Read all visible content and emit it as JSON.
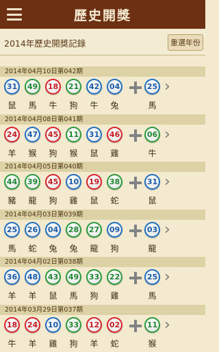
{
  "header": {
    "title": "歷史開獎"
  },
  "subheader": {
    "title": "2014年歷史開獎記錄",
    "reselect_label": "重選年份"
  },
  "colors": {
    "red": "#d8242a",
    "blue": "#1f6fc0",
    "green": "#2a9a3b",
    "topbar": "#6e3013"
  },
  "draws": [
    {
      "date": "2014年04月10日第042期",
      "balls": [
        {
          "n": "31",
          "c": "blue"
        },
        {
          "n": "49",
          "c": "green"
        },
        {
          "n": "18",
          "c": "red"
        },
        {
          "n": "21",
          "c": "green"
        },
        {
          "n": "42",
          "c": "blue"
        },
        {
          "n": "04",
          "c": "blue"
        }
      ],
      "special": {
        "n": "25",
        "c": "blue"
      },
      "zodiac": [
        "鼠",
        "馬",
        "牛",
        "狗",
        "牛",
        "兔"
      ],
      "special_zodiac": "馬"
    },
    {
      "date": "2014年04月08日第041期",
      "balls": [
        {
          "n": "24",
          "c": "red"
        },
        {
          "n": "47",
          "c": "blue"
        },
        {
          "n": "45",
          "c": "red"
        },
        {
          "n": "11",
          "c": "green"
        },
        {
          "n": "31",
          "c": "blue"
        },
        {
          "n": "46",
          "c": "red"
        }
      ],
      "special": {
        "n": "06",
        "c": "green"
      },
      "zodiac": [
        "羊",
        "猴",
        "狗",
        "猴",
        "鼠",
        "雞"
      ],
      "special_zodiac": "牛"
    },
    {
      "date": "2014年04月05日第040期",
      "balls": [
        {
          "n": "44",
          "c": "green"
        },
        {
          "n": "39",
          "c": "green"
        },
        {
          "n": "45",
          "c": "red"
        },
        {
          "n": "10",
          "c": "blue"
        },
        {
          "n": "19",
          "c": "red"
        },
        {
          "n": "38",
          "c": "green"
        }
      ],
      "special": {
        "n": "31",
        "c": "blue"
      },
      "zodiac": [
        "豬",
        "龍",
        "狗",
        "雞",
        "鼠",
        "蛇"
      ],
      "special_zodiac": "鼠"
    },
    {
      "date": "2014年04月03日第039期",
      "balls": [
        {
          "n": "25",
          "c": "blue"
        },
        {
          "n": "26",
          "c": "blue"
        },
        {
          "n": "04",
          "c": "blue"
        },
        {
          "n": "28",
          "c": "green"
        },
        {
          "n": "27",
          "c": "green"
        },
        {
          "n": "09",
          "c": "blue"
        }
      ],
      "special": {
        "n": "03",
        "c": "blue"
      },
      "zodiac": [
        "馬",
        "蛇",
        "兔",
        "兔",
        "龍",
        "狗"
      ],
      "special_zodiac": "龍"
    },
    {
      "date": "2014年04月02日第038期",
      "balls": [
        {
          "n": "36",
          "c": "blue"
        },
        {
          "n": "48",
          "c": "blue"
        },
        {
          "n": "43",
          "c": "green"
        },
        {
          "n": "49",
          "c": "green"
        },
        {
          "n": "33",
          "c": "green"
        },
        {
          "n": "22",
          "c": "green"
        }
      ],
      "special": {
        "n": "25",
        "c": "blue"
      },
      "zodiac": [
        "羊",
        "羊",
        "鼠",
        "馬",
        "狗",
        "雞"
      ],
      "special_zodiac": "馬"
    },
    {
      "date": "2014年03月29日第037期",
      "balls": [
        {
          "n": "18",
          "c": "red"
        },
        {
          "n": "24",
          "c": "red"
        },
        {
          "n": "10",
          "c": "blue"
        },
        {
          "n": "33",
          "c": "green"
        },
        {
          "n": "12",
          "c": "red"
        },
        {
          "n": "02",
          "c": "red"
        }
      ],
      "special": {
        "n": "11",
        "c": "green"
      },
      "zodiac": [
        "牛",
        "羊",
        "雞",
        "狗",
        "羊",
        "蛇"
      ],
      "special_zodiac": "猴"
    }
  ]
}
